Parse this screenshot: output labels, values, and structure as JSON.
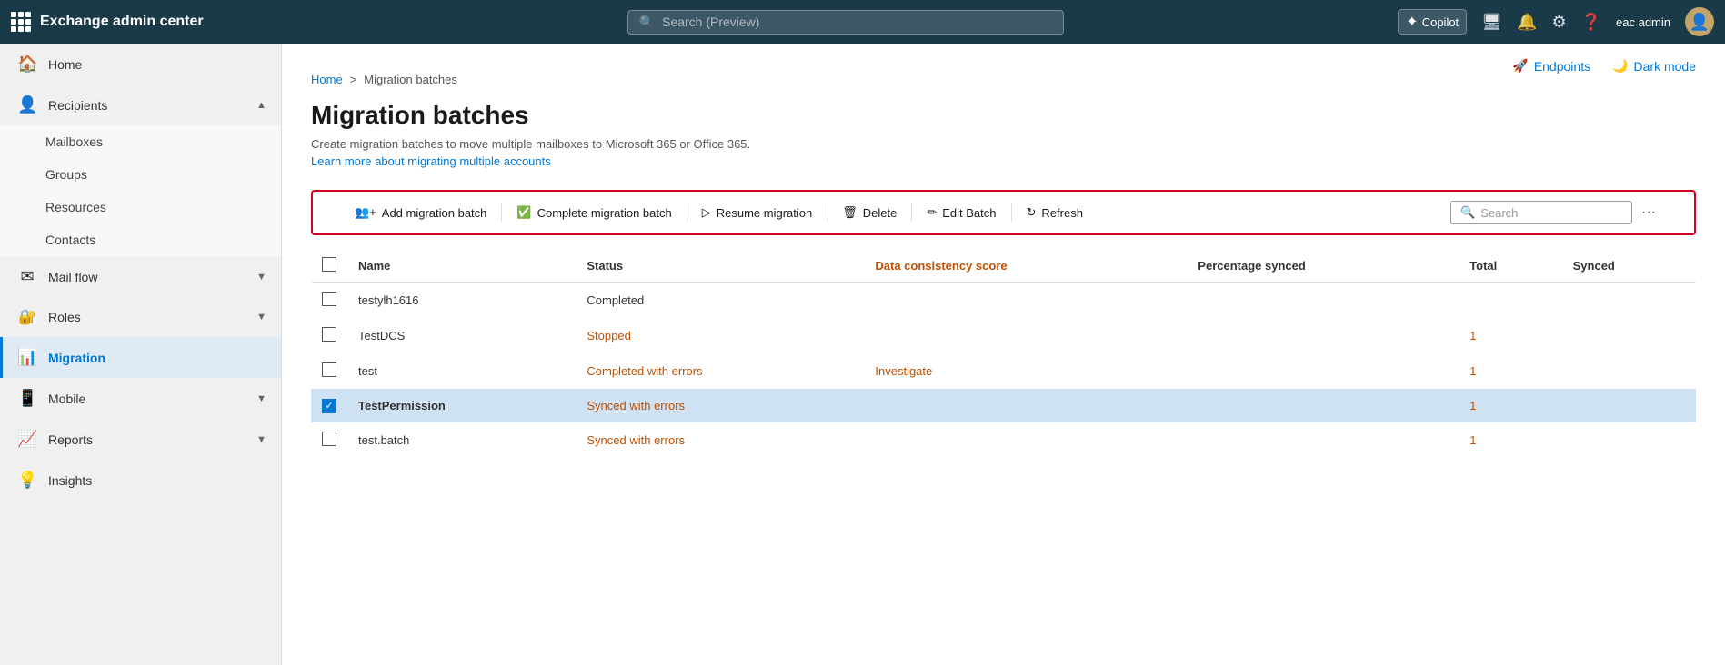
{
  "topbar": {
    "app_title": "Exchange admin center",
    "search_placeholder": "Search (Preview)",
    "copilot_label": "Copilot",
    "user_label": "eac admin"
  },
  "breadcrumb": {
    "home": "Home",
    "separator": ">",
    "current": "Migration batches"
  },
  "header_actions": {
    "endpoints_label": "Endpoints",
    "dark_mode_label": "Dark mode"
  },
  "page": {
    "title": "Migration batches",
    "description": "Create migration batches to move multiple mailboxes to Microsoft 365 or Office 365.",
    "learn_more": "Learn more about migrating multiple accounts"
  },
  "toolbar": {
    "add_label": "Add migration batch",
    "complete_label": "Complete migration batch",
    "resume_label": "Resume migration",
    "delete_label": "Delete",
    "edit_label": "Edit Batch",
    "refresh_label": "Refresh",
    "search_placeholder": "Search"
  },
  "table": {
    "columns": [
      "Name",
      "Status",
      "Data consistency score",
      "Percentage synced",
      "Total",
      "Synced"
    ],
    "rows": [
      {
        "name": "testylh1616",
        "status": "Completed",
        "data_score": "",
        "pct_synced": "",
        "total": "",
        "synced": "",
        "selected": false
      },
      {
        "name": "TestDCS",
        "status": "Stopped",
        "data_score": "",
        "pct_synced": "",
        "total": "1",
        "synced": "",
        "selected": false
      },
      {
        "name": "test",
        "status": "Completed with errors",
        "data_score": "Investigate",
        "pct_synced": "",
        "total": "1",
        "synced": "",
        "selected": false
      },
      {
        "name": "TestPermission",
        "status": "Synced with errors",
        "data_score": "",
        "pct_synced": "",
        "total": "1",
        "synced": "",
        "selected": true
      },
      {
        "name": "test.batch",
        "status": "Synced with errors",
        "data_score": "",
        "pct_synced": "",
        "total": "1",
        "synced": "",
        "selected": false
      }
    ]
  },
  "sidebar": {
    "items": [
      {
        "id": "home",
        "label": "Home",
        "icon": "🏠",
        "expandable": false
      },
      {
        "id": "recipients",
        "label": "Recipients",
        "icon": "👤",
        "expandable": true,
        "expanded": true
      },
      {
        "id": "mailboxes",
        "label": "Mailboxes",
        "sub": true
      },
      {
        "id": "groups",
        "label": "Groups",
        "sub": true
      },
      {
        "id": "resources",
        "label": "Resources",
        "sub": true
      },
      {
        "id": "contacts",
        "label": "Contacts",
        "sub": true
      },
      {
        "id": "mail-flow",
        "label": "Mail flow",
        "icon": "✉",
        "expandable": true,
        "expanded": false
      },
      {
        "id": "roles",
        "label": "Roles",
        "icon": "🔑",
        "expandable": true,
        "expanded": false
      },
      {
        "id": "migration",
        "label": "Migration",
        "icon": "📊",
        "expandable": false,
        "active": true
      },
      {
        "id": "mobile",
        "label": "Mobile",
        "icon": "📱",
        "expandable": true,
        "expanded": false
      },
      {
        "id": "reports",
        "label": "Reports",
        "icon": "📈",
        "expandable": true,
        "expanded": false
      },
      {
        "id": "insights",
        "label": "Insights",
        "icon": "💡",
        "expandable": false
      }
    ]
  }
}
